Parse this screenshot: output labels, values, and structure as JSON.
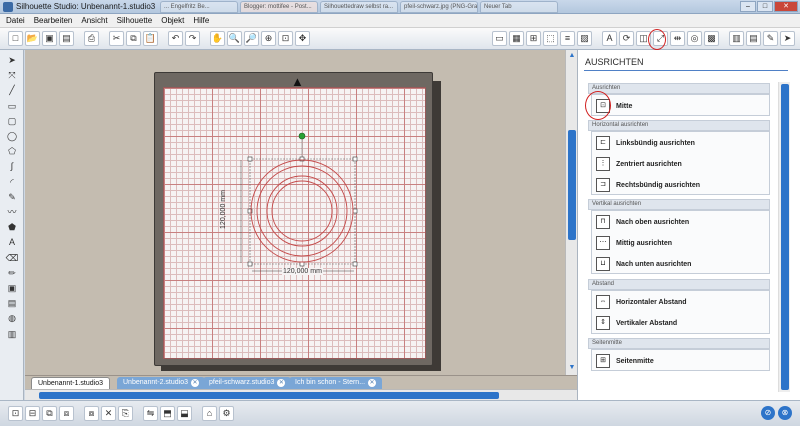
{
  "window": {
    "title": "Silhouette Studio: Unbenannt-1.studio3",
    "browser_tabs": [
      "... Engelfritz Be...",
      "Blogger: mottifee - Post...",
      "Silhouettedraw selbst ra...",
      "pfeil-schwarz.jpg (PNG-Grafi...",
      "Neuer Tab"
    ]
  },
  "menu": [
    "Datei",
    "Bearbeiten",
    "Ansicht",
    "Silhouette",
    "Objekt",
    "Hilfe"
  ],
  "toolbar": {
    "left_icons": [
      "new-icon",
      "open-icon",
      "save-icon",
      "save-as-icon",
      "print-icon",
      "cut-icon",
      "copy-icon",
      "paste-icon",
      "undo-icon",
      "redo-icon",
      "pan-icon",
      "zoom-in-icon",
      "zoom-out-icon",
      "zoom-select-icon",
      "fit-icon",
      "move-icon"
    ],
    "right_icons": [
      "page-setup-icon",
      "grid-icon",
      "registration-icon",
      "trace-icon",
      "line-style-icon",
      "fill-icon",
      "text-style-icon",
      "replicate-icon",
      "modify-icon",
      "transform-icon",
      "align-icon",
      "offset-icon",
      "fill-color-icon",
      "layers-icon",
      "library-icon",
      "cut-settings-icon",
      "send-icon"
    ],
    "glyphs_left": [
      "□",
      "📂",
      "▣",
      "▤",
      "⎙",
      "✂",
      "⧉",
      "📋",
      "↶",
      "↷",
      "✋",
      "🔍",
      "🔎",
      "⊕",
      "⊡",
      "✥"
    ],
    "glyphs_right": [
      "▭",
      "▦",
      "⊞",
      "⬚",
      "≡",
      "▨",
      "A",
      "⟳",
      "◫",
      "⤢",
      "⇹",
      "◎",
      "▩",
      "▥",
      "▤",
      "✎",
      "➤"
    ]
  },
  "left_tools": {
    "names": [
      "select-icon",
      "point-edit-icon",
      "line-icon",
      "rectangle-icon",
      "rounded-rect-icon",
      "ellipse-icon",
      "polygon-icon",
      "curve-icon",
      "arc-icon",
      "freehand-icon",
      "smooth-freehand-icon",
      "regular-polygon-icon",
      "text-icon",
      "eraser-icon",
      "knife-icon",
      "store-icon",
      "library-icon",
      "online-icon",
      "fill-icon"
    ],
    "glyphs": [
      "➤",
      "⤧",
      "╱",
      "▭",
      "▢",
      "◯",
      "⬠",
      "∫",
      "◜",
      "✎",
      "〰",
      "⬟",
      "A",
      "⌫",
      "✏",
      "▣",
      "▤",
      "◍",
      "▥"
    ]
  },
  "canvas": {
    "dimension_vertical": "120,000 mm",
    "dimension_horizontal": "120,000 mm"
  },
  "doc_tabs": [
    {
      "label": "Unbenannt-1.studio3",
      "active": true
    },
    {
      "label": "Unbenannt-2.studio3",
      "active": false
    },
    {
      "label": "pfeil-schwarz.studio3",
      "active": false
    },
    {
      "label": "Ich bin schon - Stern...",
      "active": false
    }
  ],
  "panel": {
    "title": "AUSRICHTEN",
    "sections": [
      {
        "header": "Ausrichten",
        "items": [
          {
            "label": "Mitte",
            "icon": "center-icon",
            "glyph": "⊡"
          }
        ]
      },
      {
        "header": "Horizontal ausrichten",
        "items": [
          {
            "label": "Linksbündig ausrichten",
            "icon": "align-left-icon",
            "glyph": "⊏"
          },
          {
            "label": "Zentriert ausrichten",
            "icon": "align-center-icon",
            "glyph": "⋮"
          },
          {
            "label": "Rechtsbündig ausrichten",
            "icon": "align-right-icon",
            "glyph": "⊐"
          }
        ]
      },
      {
        "header": "Vertikal ausrichten",
        "items": [
          {
            "label": "Nach oben ausrichten",
            "icon": "align-top-icon",
            "glyph": "⊓"
          },
          {
            "label": "Mittig ausrichten",
            "icon": "align-middle-icon",
            "glyph": "⋯"
          },
          {
            "label": "Nach unten ausrichten",
            "icon": "align-bottom-icon",
            "glyph": "⊔"
          }
        ]
      },
      {
        "header": "Abstand",
        "items": [
          {
            "label": "Horizontaler Abstand",
            "icon": "h-spacing-icon",
            "glyph": "⇔"
          },
          {
            "label": "Vertikaler Abstand",
            "icon": "v-spacing-icon",
            "glyph": "⇕"
          }
        ]
      },
      {
        "header": "Seitenmitte",
        "items": [
          {
            "label": "Seitenmitte",
            "icon": "page-center-icon",
            "glyph": "⊞"
          }
        ]
      }
    ]
  },
  "statusbar": {
    "left_icons": [
      "group-icon",
      "ungroup-icon",
      "compound-icon",
      "release-icon",
      "weld-icon",
      "delete-icon",
      "duplicate-icon",
      "mirror-icon",
      "bring-front-icon",
      "send-back-icon",
      "lock-icon",
      "settings-icon"
    ],
    "glyphs": [
      "⊡",
      "⊟",
      "⧉",
      "⧈",
      "⧇",
      "✕",
      "⎘",
      "⇋",
      "⬒",
      "⬓",
      "⌂",
      "⚙"
    ],
    "right_icons": [
      "hide-panel-icon",
      "close-panel-icon"
    ],
    "right_glyphs": [
      "⊘",
      "⊗"
    ]
  },
  "colors": {
    "accent": "#2d74c9",
    "highlight_circle": "#d12020",
    "shape_stroke": "#c44a4a"
  }
}
